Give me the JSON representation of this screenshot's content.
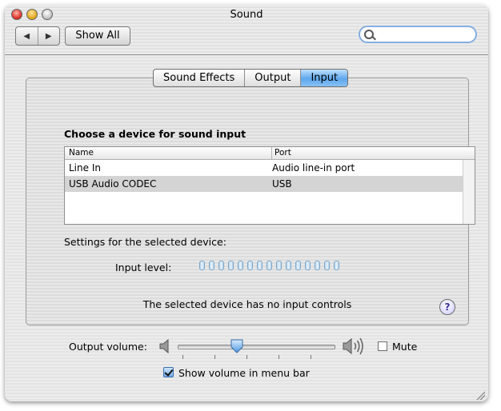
{
  "window": {
    "title": "Sound"
  },
  "toolbar": {
    "back": "◀",
    "forward": "▶",
    "show_all": "Show All",
    "search_placeholder": ""
  },
  "tabs": [
    {
      "label": "Sound Effects",
      "active": false
    },
    {
      "label": "Output",
      "active": false
    },
    {
      "label": "Input",
      "active": true
    }
  ],
  "input": {
    "heading": "Choose a device for sound input",
    "columns": [
      "Name",
      "Port"
    ],
    "rows": [
      {
        "name": "Line In",
        "port": "Audio line-in port",
        "selected": false
      },
      {
        "name": "USB Audio CODEC",
        "port": "USB",
        "selected": true
      }
    ],
    "settings_label": "Settings for the selected device:",
    "input_level_label": "Input level:",
    "input_level_segments": 15,
    "input_level_lit": 0,
    "no_controls": "The selected device has no input controls",
    "help": "?"
  },
  "bottom": {
    "output_volume_label": "Output volume:",
    "output_volume_fraction": 0.38,
    "mute_label": "Mute",
    "mute_checked": false,
    "show_volume_label": "Show volume in menu bar",
    "show_volume_checked": true
  },
  "colors": {
    "tab_active": "#5ea7ec",
    "search_ring": "#84aee2",
    "selection_row": "#d4d4d4"
  }
}
